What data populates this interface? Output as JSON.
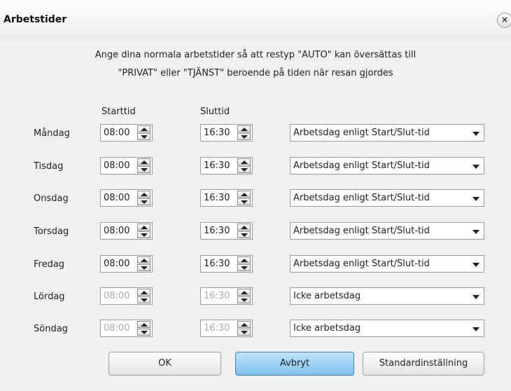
{
  "window": {
    "title": "Arbetstider",
    "close_label": "×"
  },
  "intro": {
    "line1": "Ange dina normala arbetstider så att restyp \"AUTO\" kan översättas till",
    "line2": "\"PRIVAT\" eller \"TJÄNST\" beroende på tiden när resan gjordes"
  },
  "columns": {
    "start": "Starttid",
    "end": "Sluttid"
  },
  "days": [
    {
      "name": "Måndag",
      "start": "08:00",
      "end": "16:30",
      "type": "Arbetsdag enligt Start/Slut-tid",
      "enabled": true
    },
    {
      "name": "Tisdag",
      "start": "08:00",
      "end": "16:30",
      "type": "Arbetsdag enligt Start/Slut-tid",
      "enabled": true
    },
    {
      "name": "Onsdag",
      "start": "08:00",
      "end": "16:30",
      "type": "Arbetsdag enligt Start/Slut-tid",
      "enabled": true
    },
    {
      "name": "Torsdag",
      "start": "08:00",
      "end": "16:30",
      "type": "Arbetsdag enligt Start/Slut-tid",
      "enabled": true
    },
    {
      "name": "Fredag",
      "start": "08:00",
      "end": "16:30",
      "type": "Arbetsdag enligt Start/Slut-tid",
      "enabled": true
    },
    {
      "name": "Lördag",
      "start": "08:00",
      "end": "16:30",
      "type": "Icke arbetsdag",
      "enabled": false
    },
    {
      "name": "Söndag",
      "start": "08:00",
      "end": "16:30",
      "type": "Icke arbetsdag",
      "enabled": false
    }
  ],
  "buttons": {
    "ok": "OK",
    "cancel": "Avbryt",
    "defaults": "Standardinställning"
  },
  "colors": {
    "primary_button": "#7fc1ee",
    "disabled_text": "#aaaaaa"
  }
}
